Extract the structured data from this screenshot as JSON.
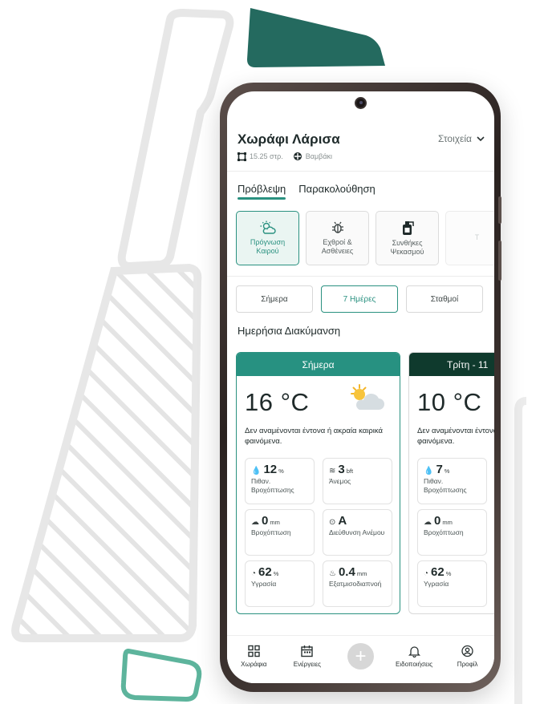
{
  "header": {
    "field_name": "Χωράφι Λάρισα",
    "details_label": "Στοιχεία",
    "area": "15.25 στρ.",
    "crop": "Βαμβάκι"
  },
  "tabs": [
    {
      "label": "Πρόβλεψη",
      "active": true
    },
    {
      "label": "Παρακολούθηση",
      "active": false
    }
  ],
  "categories": [
    {
      "icon": "weather-sun-cloud-icon",
      "line1": "Πρόγνωση",
      "line2": "Καιρού",
      "active": true
    },
    {
      "icon": "bug-icon",
      "line1": "Εχθροί &",
      "line2": "Ασθένειες",
      "active": false
    },
    {
      "icon": "sprayer-icon",
      "line1": "Συνθήκες",
      "line2": "Ψεκασμού",
      "active": false
    },
    {
      "icon": "",
      "line1": "Τ",
      "line2": "",
      "active": false
    }
  ],
  "segments": [
    {
      "label": "Σήμερα",
      "active": false
    },
    {
      "label": "7 Ημέρες",
      "active": true
    },
    {
      "label": "Σταθμοί",
      "active": false
    }
  ],
  "section_title": "Ημερήσια Διακύμανση",
  "days": [
    {
      "label": "Σήμερα",
      "temperature": "16 °C",
      "description": "Δεν αναμένονται έντονα ή ακραία καιρικά φαινόμενα.",
      "weather_icon": "sun-cloud-icon",
      "stats": [
        {
          "icon": "drop-percent-icon",
          "value": "12",
          "unit": "%",
          "label": "Πιθαν. Βροχόπτωσης"
        },
        {
          "icon": "wind-icon",
          "value": "3",
          "unit": "bft",
          "label": "Άνεμος"
        },
        {
          "icon": "rain-cloud-icon",
          "value": "0",
          "unit": "mm",
          "label": "Βροχόπτωση"
        },
        {
          "icon": "compass-icon",
          "value": "A",
          "unit": "",
          "label": "Διεύθυνση Ανέμου"
        },
        {
          "icon": "humidity-icon",
          "value": "62",
          "unit": "%",
          "label": "Υγρασία"
        },
        {
          "icon": "evaporation-icon",
          "value": "0.4",
          "unit": "mm",
          "label": "Εξατμισοδιαπνοή"
        }
      ]
    },
    {
      "label": "Τρίτη - 11",
      "temperature": "10 °C",
      "description": "Δεν αναμένονται έντονα ή ακραία καιρικά φαινόμενα.",
      "stats": [
        {
          "icon": "drop-percent-icon",
          "value": "7",
          "unit": "%",
          "label": "Πιθαν. Βροχόπτωσης"
        },
        {
          "icon": "rain-cloud-icon",
          "value": "0",
          "unit": "mm",
          "label": "Βροχόπτωση"
        },
        {
          "icon": "humidity-icon",
          "value": "62",
          "unit": "%",
          "label": "Υγρασία"
        }
      ]
    }
  ],
  "bottom_nav": [
    {
      "icon": "grid-icon",
      "label": "Χωράφια"
    },
    {
      "icon": "calendar-icon",
      "label": "Ενέργειες"
    },
    {
      "icon": "plus-icon",
      "label": ""
    },
    {
      "icon": "bell-icon",
      "label": "Ειδοποιήσεις"
    },
    {
      "icon": "user-icon",
      "label": "Προφίλ"
    }
  ],
  "colors": {
    "primary": "#2a9180",
    "dark_green": "#0f3a2d",
    "decor_green": "#246a5f",
    "decor_mint": "#5db49c",
    "decor_grey": "#e7e7e7"
  }
}
